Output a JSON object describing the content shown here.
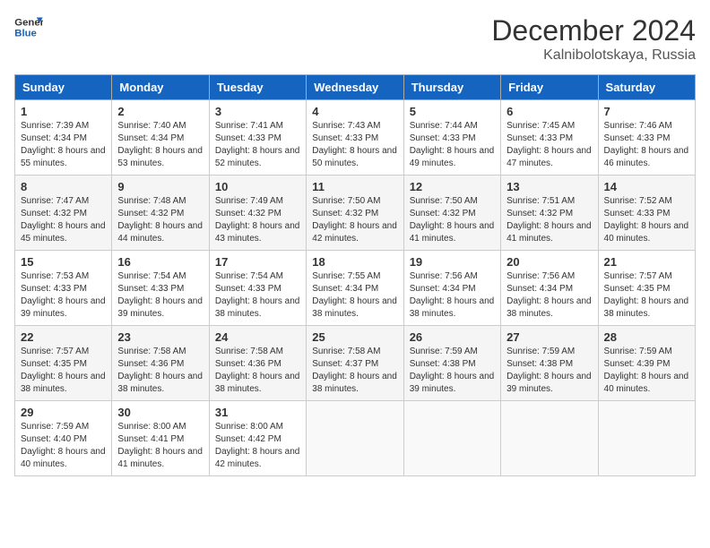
{
  "header": {
    "logo_line1": "General",
    "logo_line2": "Blue",
    "month_title": "December 2024",
    "location": "Kalnibolotskaya, Russia"
  },
  "days_of_week": [
    "Sunday",
    "Monday",
    "Tuesday",
    "Wednesday",
    "Thursday",
    "Friday",
    "Saturday"
  ],
  "weeks": [
    [
      {
        "day": "1",
        "sunrise": "Sunrise: 7:39 AM",
        "sunset": "Sunset: 4:34 PM",
        "daylight": "Daylight: 8 hours and 55 minutes."
      },
      {
        "day": "2",
        "sunrise": "Sunrise: 7:40 AM",
        "sunset": "Sunset: 4:34 PM",
        "daylight": "Daylight: 8 hours and 53 minutes."
      },
      {
        "day": "3",
        "sunrise": "Sunrise: 7:41 AM",
        "sunset": "Sunset: 4:33 PM",
        "daylight": "Daylight: 8 hours and 52 minutes."
      },
      {
        "day": "4",
        "sunrise": "Sunrise: 7:43 AM",
        "sunset": "Sunset: 4:33 PM",
        "daylight": "Daylight: 8 hours and 50 minutes."
      },
      {
        "day": "5",
        "sunrise": "Sunrise: 7:44 AM",
        "sunset": "Sunset: 4:33 PM",
        "daylight": "Daylight: 8 hours and 49 minutes."
      },
      {
        "day": "6",
        "sunrise": "Sunrise: 7:45 AM",
        "sunset": "Sunset: 4:33 PM",
        "daylight": "Daylight: 8 hours and 47 minutes."
      },
      {
        "day": "7",
        "sunrise": "Sunrise: 7:46 AM",
        "sunset": "Sunset: 4:33 PM",
        "daylight": "Daylight: 8 hours and 46 minutes."
      }
    ],
    [
      {
        "day": "8",
        "sunrise": "Sunrise: 7:47 AM",
        "sunset": "Sunset: 4:32 PM",
        "daylight": "Daylight: 8 hours and 45 minutes."
      },
      {
        "day": "9",
        "sunrise": "Sunrise: 7:48 AM",
        "sunset": "Sunset: 4:32 PM",
        "daylight": "Daylight: 8 hours and 44 minutes."
      },
      {
        "day": "10",
        "sunrise": "Sunrise: 7:49 AM",
        "sunset": "Sunset: 4:32 PM",
        "daylight": "Daylight: 8 hours and 43 minutes."
      },
      {
        "day": "11",
        "sunrise": "Sunrise: 7:50 AM",
        "sunset": "Sunset: 4:32 PM",
        "daylight": "Daylight: 8 hours and 42 minutes."
      },
      {
        "day": "12",
        "sunrise": "Sunrise: 7:50 AM",
        "sunset": "Sunset: 4:32 PM",
        "daylight": "Daylight: 8 hours and 41 minutes."
      },
      {
        "day": "13",
        "sunrise": "Sunrise: 7:51 AM",
        "sunset": "Sunset: 4:32 PM",
        "daylight": "Daylight: 8 hours and 41 minutes."
      },
      {
        "day": "14",
        "sunrise": "Sunrise: 7:52 AM",
        "sunset": "Sunset: 4:33 PM",
        "daylight": "Daylight: 8 hours and 40 minutes."
      }
    ],
    [
      {
        "day": "15",
        "sunrise": "Sunrise: 7:53 AM",
        "sunset": "Sunset: 4:33 PM",
        "daylight": "Daylight: 8 hours and 39 minutes."
      },
      {
        "day": "16",
        "sunrise": "Sunrise: 7:54 AM",
        "sunset": "Sunset: 4:33 PM",
        "daylight": "Daylight: 8 hours and 39 minutes."
      },
      {
        "day": "17",
        "sunrise": "Sunrise: 7:54 AM",
        "sunset": "Sunset: 4:33 PM",
        "daylight": "Daylight: 8 hours and 38 minutes."
      },
      {
        "day": "18",
        "sunrise": "Sunrise: 7:55 AM",
        "sunset": "Sunset: 4:34 PM",
        "daylight": "Daylight: 8 hours and 38 minutes."
      },
      {
        "day": "19",
        "sunrise": "Sunrise: 7:56 AM",
        "sunset": "Sunset: 4:34 PM",
        "daylight": "Daylight: 8 hours and 38 minutes."
      },
      {
        "day": "20",
        "sunrise": "Sunrise: 7:56 AM",
        "sunset": "Sunset: 4:34 PM",
        "daylight": "Daylight: 8 hours and 38 minutes."
      },
      {
        "day": "21",
        "sunrise": "Sunrise: 7:57 AM",
        "sunset": "Sunset: 4:35 PM",
        "daylight": "Daylight: 8 hours and 38 minutes."
      }
    ],
    [
      {
        "day": "22",
        "sunrise": "Sunrise: 7:57 AM",
        "sunset": "Sunset: 4:35 PM",
        "daylight": "Daylight: 8 hours and 38 minutes."
      },
      {
        "day": "23",
        "sunrise": "Sunrise: 7:58 AM",
        "sunset": "Sunset: 4:36 PM",
        "daylight": "Daylight: 8 hours and 38 minutes."
      },
      {
        "day": "24",
        "sunrise": "Sunrise: 7:58 AM",
        "sunset": "Sunset: 4:36 PM",
        "daylight": "Daylight: 8 hours and 38 minutes."
      },
      {
        "day": "25",
        "sunrise": "Sunrise: 7:58 AM",
        "sunset": "Sunset: 4:37 PM",
        "daylight": "Daylight: 8 hours and 38 minutes."
      },
      {
        "day": "26",
        "sunrise": "Sunrise: 7:59 AM",
        "sunset": "Sunset: 4:38 PM",
        "daylight": "Daylight: 8 hours and 39 minutes."
      },
      {
        "day": "27",
        "sunrise": "Sunrise: 7:59 AM",
        "sunset": "Sunset: 4:38 PM",
        "daylight": "Daylight: 8 hours and 39 minutes."
      },
      {
        "day": "28",
        "sunrise": "Sunrise: 7:59 AM",
        "sunset": "Sunset: 4:39 PM",
        "daylight": "Daylight: 8 hours and 40 minutes."
      }
    ],
    [
      {
        "day": "29",
        "sunrise": "Sunrise: 7:59 AM",
        "sunset": "Sunset: 4:40 PM",
        "daylight": "Daylight: 8 hours and 40 minutes."
      },
      {
        "day": "30",
        "sunrise": "Sunrise: 8:00 AM",
        "sunset": "Sunset: 4:41 PM",
        "daylight": "Daylight: 8 hours and 41 minutes."
      },
      {
        "day": "31",
        "sunrise": "Sunrise: 8:00 AM",
        "sunset": "Sunset: 4:42 PM",
        "daylight": "Daylight: 8 hours and 42 minutes."
      },
      null,
      null,
      null,
      null
    ]
  ]
}
